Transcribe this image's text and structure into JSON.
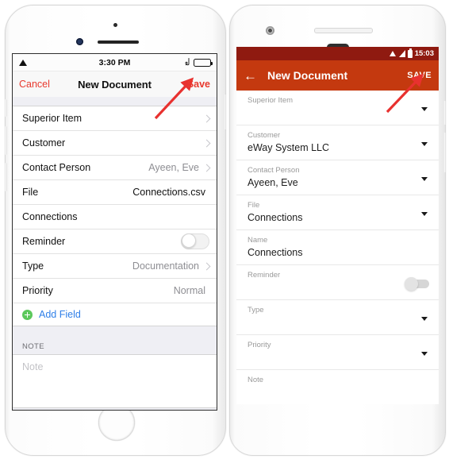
{
  "ios": {
    "status": {
      "time": "3:30 PM",
      "wifi_icon": "wifi-icon",
      "bluetooth_icon": "bluetooth-icon",
      "battery_icon": "battery-icon"
    },
    "nav": {
      "cancel_label": "Cancel",
      "title": "New Document",
      "save_label": "Save"
    },
    "rows": [
      {
        "label": "Superior Item",
        "value": "",
        "accessory": "chevron"
      },
      {
        "label": "Customer",
        "value": "",
        "accessory": "chevron"
      },
      {
        "label": "Contact Person",
        "value": "Ayeen, Eve",
        "accessory": "chevron"
      },
      {
        "label": "File",
        "value": "Connections.csv",
        "accessory": "none",
        "value_dark": true
      },
      {
        "label": "Connections",
        "value": "",
        "accessory": "none"
      },
      {
        "label": "Reminder",
        "value": "",
        "accessory": "toggle"
      },
      {
        "label": "Type",
        "value": "Documentation",
        "accessory": "chevron"
      },
      {
        "label": "Priority",
        "value": "Normal",
        "accessory": "none"
      }
    ],
    "add_field_label": "Add Field",
    "note_header": "NOTE",
    "note_placeholder": "Note"
  },
  "android": {
    "status": {
      "time": "15:03",
      "wifi_icon": "wifi-icon",
      "signal_icon": "signal-icon",
      "battery_icon": "battery-icon"
    },
    "bar": {
      "back_icon": "back-arrow-icon",
      "title": "New Document",
      "save_label": "SAVE"
    },
    "fields": [
      {
        "label": "Superior Item",
        "value": "",
        "accessory": "caret"
      },
      {
        "label": "Customer",
        "value": "eWay System LLC",
        "accessory": "caret"
      },
      {
        "label": "Contact Person",
        "value": "Ayeen, Eve",
        "accessory": "caret"
      },
      {
        "label": "File",
        "value": "Connections",
        "accessory": "caret"
      },
      {
        "label": "Name",
        "value": "Connections",
        "accessory": "none"
      },
      {
        "label": "Reminder",
        "value": "",
        "accessory": "toggle"
      },
      {
        "label": "Type",
        "value": "",
        "accessory": "caret"
      },
      {
        "label": "Priority",
        "value": "",
        "accessory": "caret"
      },
      {
        "label": "Note",
        "value": "",
        "accessory": "none"
      }
    ]
  },
  "annotations": {
    "arrow_color": "#e8312f",
    "ios_arrow_target": "Save",
    "android_arrow_target": "SAVE"
  },
  "colors": {
    "ios_accent_red": "#e8392e",
    "ios_link_blue": "#2f7fe8",
    "ios_add_green": "#5cc85c",
    "android_toolbar": "#c4390f",
    "android_statusbar": "#8f1a10"
  }
}
